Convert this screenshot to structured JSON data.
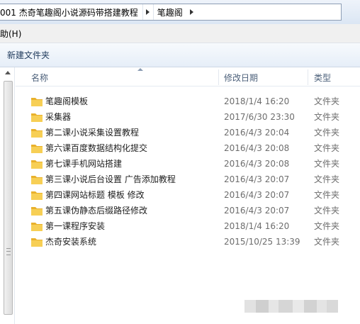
{
  "address": {
    "crumbs": [
      "001 杰奇笔趣阁小说源码带搭建教程",
      "笔趣阁"
    ]
  },
  "menu": {
    "items": [
      "助(H)"
    ]
  },
  "toolbar": {
    "new_folder_label": "新建文件夹"
  },
  "columns": {
    "name": "名称",
    "date": "修改日期",
    "type": "类型"
  },
  "files": [
    {
      "name": "笔趣阁模板",
      "date": "2018/1/4 16:20",
      "type": "文件夹"
    },
    {
      "name": "采集器",
      "date": "2017/6/30 23:30",
      "type": "文件夹"
    },
    {
      "name": "第二课小说采集设置教程",
      "date": "2016/4/3 20:04",
      "type": "文件夹"
    },
    {
      "name": "第六课百度数据结构化提交",
      "date": "2016/4/3 20:08",
      "type": "文件夹"
    },
    {
      "name": "第七课手机网站搭建",
      "date": "2016/4/3 20:08",
      "type": "文件夹"
    },
    {
      "name": "第三课小说后台设置 广告添加教程",
      "date": "2016/4/3 20:07",
      "type": "文件夹"
    },
    {
      "name": "第四课网站标题 模板 修改",
      "date": "2016/4/3 20:07",
      "type": "文件夹"
    },
    {
      "name": "第五课伪静态后缀路径修改",
      "date": "2016/4/3 20:07",
      "type": "文件夹"
    },
    {
      "name": "第一课程序安装",
      "date": "2018/1/4 16:20",
      "type": "文件夹"
    },
    {
      "name": "杰奇安装系统",
      "date": "2015/10/25 13:39",
      "type": "文件夹"
    }
  ],
  "icons": {
    "folder": "folder-icon",
    "breadcrumb_separator": "chevron-right-icon",
    "sort": "sort-up-icon",
    "scroll_up": "scroll-up-arrow-icon"
  },
  "colors": {
    "folder": "#f5c342",
    "header_text": "#4c607a",
    "meta_text": "#6d6d6d"
  }
}
